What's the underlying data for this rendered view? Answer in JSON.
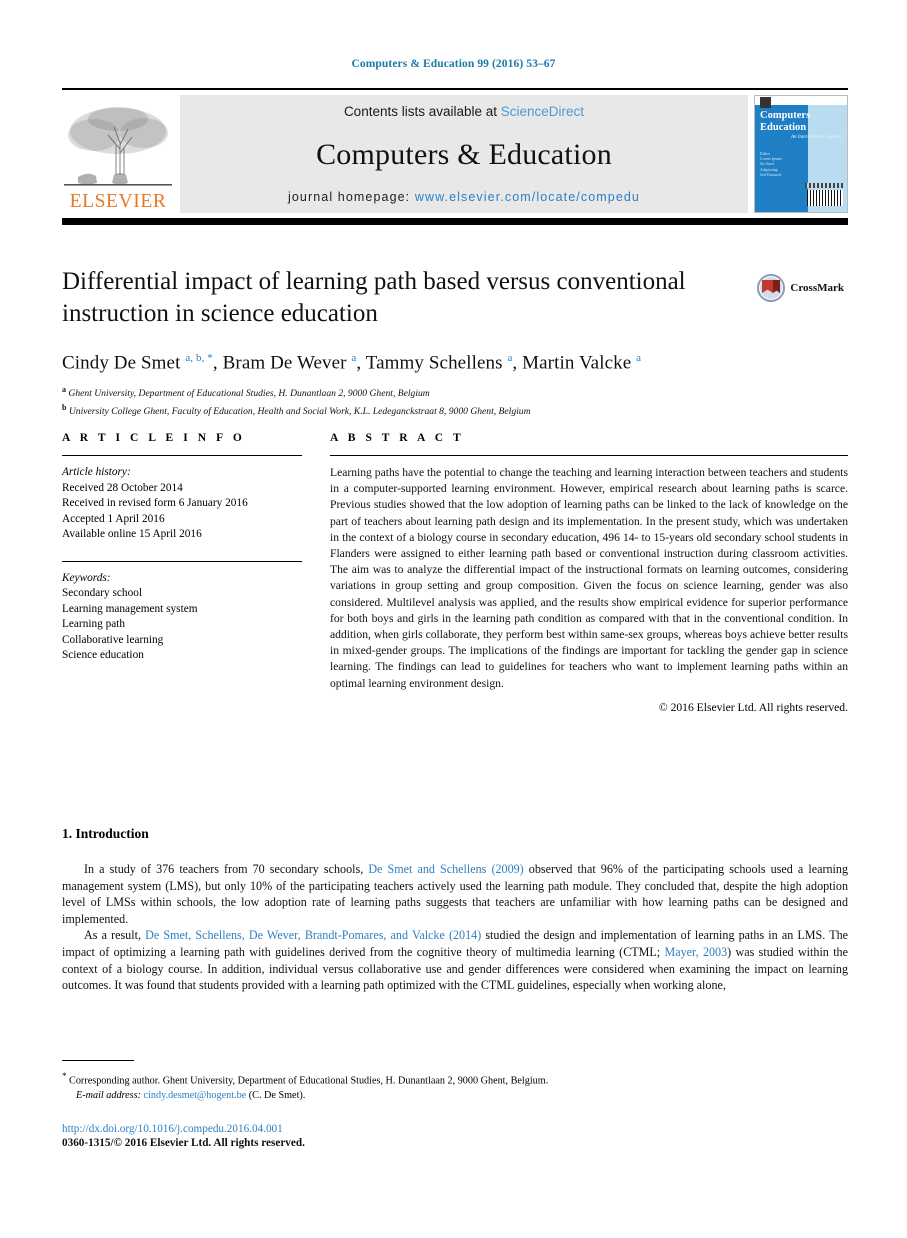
{
  "running_head": "Computers & Education 99 (2016) 53–67",
  "masthead": {
    "contents_prefix": "Contents lists available at ",
    "sciencedirect": "ScienceDirect",
    "journal_title": "Computers & Education",
    "homepage_prefix": "journal homepage: ",
    "homepage_url": "www.elsevier.com/locate/compedu",
    "publisher_wordmark": "ELSEVIER",
    "cover": {
      "title_line1": "Computers",
      "title_line2": "Education",
      "subtitle": "An International Journal",
      "editors": "Editor\nLorem Ipsum Dolor\nSit Amet Consect\nAdipiscing Elit\nSed Do Eiusmod"
    }
  },
  "article": {
    "title": "Differential impact of learning path based versus conventional instruction in science education",
    "crossmark_label": "CrossMark",
    "authors_html": "Cindy De Smet <sup>a, b, *</sup>, Bram De Wever <sup>a</sup>, Tammy Schellens <sup>a</sup>, Martin Valcke <sup>a</sup>",
    "affiliations": [
      {
        "marker": "a",
        "text": "Ghent University, Department of Educational Studies, H. Dunantlaan 2, 9000 Ghent, Belgium"
      },
      {
        "marker": "b",
        "text": "University College Ghent, Faculty of Education, Health and Social Work, K.L. Ledeganckstraat 8, 9000 Ghent, Belgium"
      }
    ]
  },
  "article_info": {
    "heading": "A R T I C L E   I N F O",
    "history_label": "Article history:",
    "history": [
      "Received 28 October 2014",
      "Received in revised form 6 January 2016",
      "Accepted 1 April 2016",
      "Available online 15 April 2016"
    ],
    "keywords_label": "Keywords:",
    "keywords": [
      "Secondary school",
      "Learning management system",
      "Learning path",
      "Collaborative learning",
      "Science education"
    ]
  },
  "abstract": {
    "heading": "A B S T R A C T",
    "text": "Learning paths have the potential to change the teaching and learning interaction between teachers and students in a computer-supported learning environment. However, empirical research about learning paths is scarce. Previous studies showed that the low adoption of learning paths can be linked to the lack of knowledge on the part of teachers about learning path design and its implementation. In the present study, which was undertaken in the context of a biology course in secondary education, 496 14- to 15-years old secondary school students in Flanders were assigned to either learning path based or conventional instruction during classroom activities. The aim was to analyze the differential impact of the instructional formats on learning outcomes, considering variations in group setting and group composition. Given the focus on science learning, gender was also considered. Multilevel analysis was applied, and the results show empirical evidence for superior performance for both boys and girls in the learning path condition as compared with that in the conventional condition. In addition, when girls collaborate, they perform best within same-sex groups, whereas boys achieve better results in mixed-gender groups. The implications of the findings are important for tackling the gender gap in science learning. The findings can lead to guidelines for teachers who want to implement learning paths within an optimal learning environment design.",
    "copyright": "© 2016 Elsevier Ltd. All rights reserved."
  },
  "introduction": {
    "heading": "1.  Introduction",
    "paragraph1": {
      "part1": "In a study of 376 teachers from 70 secondary schools, ",
      "citation1": "De Smet and Schellens (2009)",
      "part2": " observed that 96% of the participating schools used a learning management system (LMS), but only 10% of the participating teachers actively used the learning path module. They concluded that, despite the high adoption level of LMSs within schools, the low adoption rate of learning paths suggests that teachers are unfamiliar with how learning paths can be designed and implemented."
    },
    "paragraph2": {
      "part1": "As a result, ",
      "citation1": "De Smet, Schellens, De Wever, Brandt-Pomares, and Valcke (2014)",
      "part2": " studied the design and implementation of learning paths in an LMS. The impact of optimizing a learning path with guidelines derived from the cognitive theory of multimedia learning (CTML; ",
      "citation2": "Mayer, 2003",
      "part3": ") was studied within the context of a biology course. In addition, individual versus collaborative use and gender differences were considered when examining the impact on learning outcomes. It was found that students provided with a learning path optimized with the CTML guidelines, especially when working alone,"
    }
  },
  "footer": {
    "corresponding_marker": "*",
    "corresponding_text": " Corresponding author. Ghent University, Department of Educational Studies, H. Dunantlaan 2, 9000 Ghent, Belgium.",
    "email_label": "E-mail address:",
    "email": "cindy.desmet@hogent.be",
    "email_suffix": " (C. De Smet).",
    "doi": "http://dx.doi.org/10.1016/j.compedu.2016.04.001",
    "issn_copyright": "0360-1315/© 2016 Elsevier Ltd. All rights reserved."
  },
  "colors": {
    "link": "#2f7fc1",
    "running_head": "#1a7aa8",
    "elsevier_orange": "#E87722",
    "cover_blue": "#1f7fc4"
  }
}
